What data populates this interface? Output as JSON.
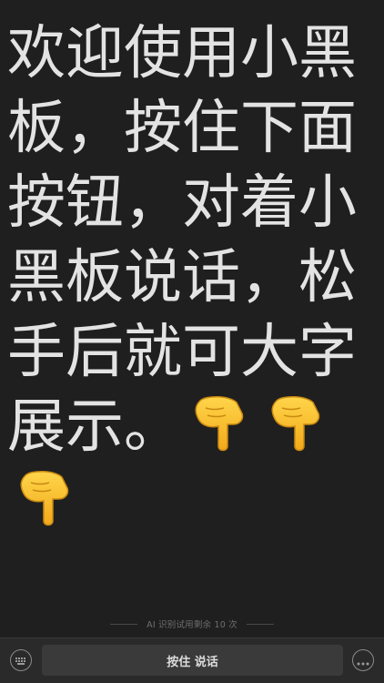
{
  "board": {
    "text": "欢迎使用小黑板，按住下面按钮，对着小黑板说话，松手后就可大字展示。",
    "emoji": [
      "pointing-down-hand",
      "pointing-down-hand",
      "pointing-down-hand"
    ]
  },
  "hint": {
    "text": "AI 识别试用剩余 10 次"
  },
  "toolbar": {
    "keyboard_icon": "keyboard-icon",
    "hold_to_talk_label": "按住 说话",
    "more_icon": "more-icon"
  },
  "colors": {
    "background": "#1f1f1f",
    "text": "#e3e3e3",
    "toolbar": "#2a2a2a",
    "button": "#3a3a3a",
    "emoji": "#f6c23a"
  }
}
